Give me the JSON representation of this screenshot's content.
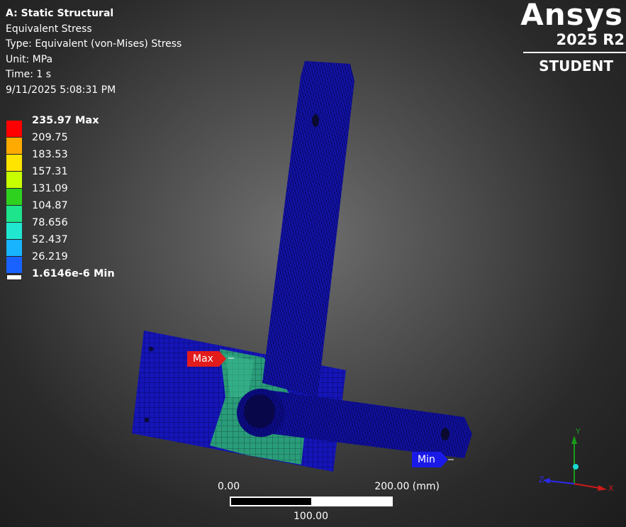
{
  "info": {
    "title": "A: Static Structural",
    "result": "Equivalent Stress",
    "type": "Type: Equivalent (von-Mises) Stress",
    "unit": "Unit: MPa",
    "time": "Time: 1 s",
    "timestamp": "9/11/2025 5:08:31 PM"
  },
  "legend": {
    "labels": [
      "235.97 Max",
      "209.75",
      "183.53",
      "157.31",
      "131.09",
      "104.87",
      "78.656",
      "52.437",
      "26.219",
      "1.6146e-6 Min"
    ],
    "colors": [
      "#ff0000",
      "#ffaa00",
      "#ffe400",
      "#c8ff00",
      "#2fd11f",
      "#1ee48c",
      "#20e8d0",
      "#18b4ff",
      "#1a62ff",
      "#0000ff"
    ]
  },
  "logo": {
    "brand": "Ansys",
    "version": "2025 R2",
    "edition": "STUDENT"
  },
  "probes": {
    "max": "Max",
    "min": "Min"
  },
  "scale": {
    "left": "0.00",
    "right": "200.00 (mm)",
    "middle": "100.00"
  },
  "triad": {
    "x": "X",
    "y": "Y",
    "z": "Z"
  }
}
